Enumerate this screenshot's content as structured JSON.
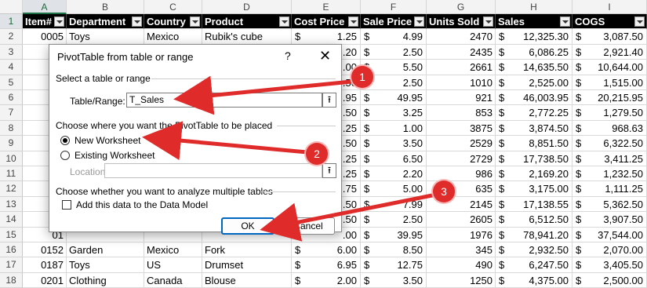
{
  "columns": [
    "A",
    "B",
    "C",
    "D",
    "E",
    "F",
    "G",
    "H",
    "I"
  ],
  "rows": [
    "1",
    "2",
    "3",
    "4",
    "5",
    "6",
    "7",
    "8",
    "9",
    "10",
    "11",
    "12",
    "13",
    "14",
    "15",
    "16",
    "17",
    "18"
  ],
  "headers": [
    "Item#",
    "Department",
    "Country",
    "Product",
    "Cost Price",
    "Sale Price",
    "Units Sold",
    "Sales",
    "COGS"
  ],
  "table_rows": [
    {
      "a": "0005",
      "b": "Toys",
      "c": "Mexico",
      "d": "Rubik's cube",
      "e": "1.25",
      "f": "4.99",
      "g": "2470",
      "h": "12,325.30",
      "i": "3,087.50"
    },
    {
      "a": "00",
      "b": "",
      "c": "",
      "d": "",
      "e": ".20",
      "f": "2.50",
      "g": "2435",
      "h": "6,086.25",
      "i": "2,921.40"
    },
    {
      "a": "00",
      "b": "",
      "c": "",
      "d": "",
      "e": ".00",
      "f": "5.50",
      "g": "2661",
      "h": "14,635.50",
      "i": "10,644.00"
    },
    {
      "a": "00",
      "b": "",
      "c": "",
      "d": "",
      "e": ".50",
      "f": "2.50",
      "g": "1010",
      "h": "2,525.00",
      "i": "1,515.00"
    },
    {
      "a": "00",
      "b": "",
      "c": "",
      "d": "",
      "e": ".95",
      "f": "49.95",
      "g": "921",
      "h": "46,003.95",
      "i": "20,215.95"
    },
    {
      "a": "00",
      "b": "",
      "c": "",
      "d": "",
      "e": ".50",
      "f": "3.25",
      "g": "853",
      "h": "2,772.25",
      "i": "1,279.50"
    },
    {
      "a": "00",
      "b": "",
      "c": "",
      "d": "",
      "e": ".25",
      "f": "1.00",
      "g": "3875",
      "h": "3,874.50",
      "i": "968.63"
    },
    {
      "a": "00",
      "b": "",
      "c": "",
      "d": "",
      "e": ".50",
      "f": "3.50",
      "g": "2529",
      "h": "8,851.50",
      "i": "6,322.50"
    },
    {
      "a": "00",
      "b": "",
      "c": "",
      "d": "",
      "e": ".25",
      "f": "6.50",
      "g": "2729",
      "h": "17,738.50",
      "i": "3,411.25"
    },
    {
      "a": "00",
      "b": "",
      "c": "",
      "d": "",
      "e": ".25",
      "f": "2.20",
      "g": "986",
      "h": "2,169.20",
      "i": "1,232.50"
    },
    {
      "a": "01",
      "b": "",
      "c": "",
      "d": "",
      "e": ".75",
      "f": "5.00",
      "g": "635",
      "h": "3,175.00",
      "i": "1,111.25"
    },
    {
      "a": "01",
      "b": "",
      "c": "",
      "d": "",
      "e": ".50",
      "f": "7.99",
      "g": "2145",
      "h": "17,138.55",
      "i": "5,362.50"
    },
    {
      "a": "01",
      "b": "",
      "c": "",
      "d": "",
      "e": ".50",
      "f": "2.50",
      "g": "2605",
      "h": "6,512.50",
      "i": "3,907.50"
    },
    {
      "a": "01",
      "b": "",
      "c": "",
      "d": "",
      "e": ".00",
      "f": "39.95",
      "g": "1976",
      "h": "78,941.20",
      "i": "37,544.00"
    },
    {
      "a": "0152",
      "b": "Garden",
      "c": "Mexico",
      "d": "Fork",
      "e": "6.00",
      "f": "8.50",
      "g": "345",
      "h": "2,932.50",
      "i": "2,070.00"
    },
    {
      "a": "0187",
      "b": "Toys",
      "c": "US",
      "d": "Drumset",
      "e": "6.95",
      "f": "12.75",
      "g": "490",
      "h": "6,247.50",
      "i": "3,405.50"
    },
    {
      "a": "0201",
      "b": "Clothing",
      "c": "Canada",
      "d": "Blouse",
      "e": "2.00",
      "f": "3.50",
      "g": "1250",
      "h": "4,375.00",
      "i": "2,500.00"
    }
  ],
  "currency_symbol": "$",
  "dialog": {
    "title": "PivotTable from table or range",
    "help": "?",
    "close": "✕",
    "section1": "Select a table or range",
    "table_range_label": "Table/Range:",
    "table_range_value": "T_Sales",
    "section2": "Choose where you want the PivotTable to be placed",
    "option_new": "New Worksheet",
    "option_existing": "Existing Worksheet",
    "location_label": "Location:",
    "location_value": "",
    "section3": "Choose whether you want to analyze multiple tables",
    "data_model_label": "Add this data to the Data Model",
    "ok": "OK",
    "cancel": "Cancel"
  },
  "callouts": [
    "1",
    "2",
    "3"
  ],
  "colors": {
    "accent_red": "#e02b2b",
    "header_bg": "#000000",
    "excel_green": "#1e7145"
  }
}
